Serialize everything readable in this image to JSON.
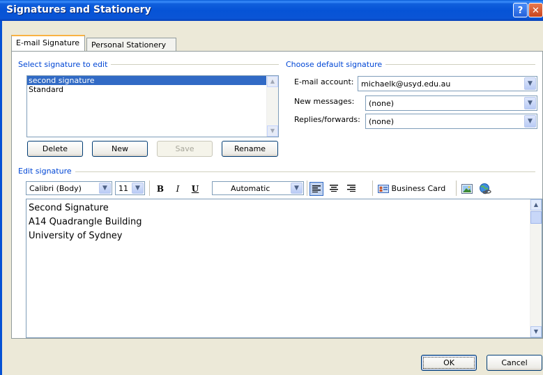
{
  "window": {
    "title": "Signatures and Stationery",
    "help_label": "?",
    "close_label": "✕"
  },
  "tabs": [
    {
      "label": "E-mail Signature",
      "active": true
    },
    {
      "label": "Personal Stationery",
      "active": false
    }
  ],
  "select_signature": {
    "group_label": "Select signature to edit",
    "items": [
      "second signature",
      "Standard"
    ],
    "selected_index": 0,
    "buttons": {
      "delete": "Delete",
      "new": "New",
      "save": "Save",
      "rename": "Rename"
    }
  },
  "default_signature": {
    "group_label": "Choose default signature",
    "email_account_label": "E-mail account:",
    "email_account_value": "michaelk@usyd.edu.au",
    "new_messages_label": "New messages:",
    "new_messages_value": "(none)",
    "replies_label": "Replies/forwards:",
    "replies_value": "(none)"
  },
  "edit_signature": {
    "group_label": "Edit signature",
    "font_value": "Calibri (Body)",
    "size_value": "11",
    "bold_label": "B",
    "italic_label": "I",
    "underline_label": "U",
    "color_value": "Automatic",
    "business_card_label": "Business Card",
    "content_lines": [
      "Second Signature",
      "A14 Quadrangle Building",
      "University of Sydney"
    ]
  },
  "footer": {
    "ok_label": "OK",
    "cancel_label": "Cancel"
  },
  "colors": {
    "title_bar": "#0653d6",
    "group_label": "#0046d5",
    "selection": "#316ac5",
    "dialog_bg": "#ece9d8"
  },
  "icons": [
    "help-icon",
    "close-icon",
    "chevron-down-icon",
    "align-left-icon",
    "align-center-icon",
    "align-right-icon",
    "business-card-icon",
    "insert-picture-icon",
    "insert-hyperlink-icon"
  ]
}
